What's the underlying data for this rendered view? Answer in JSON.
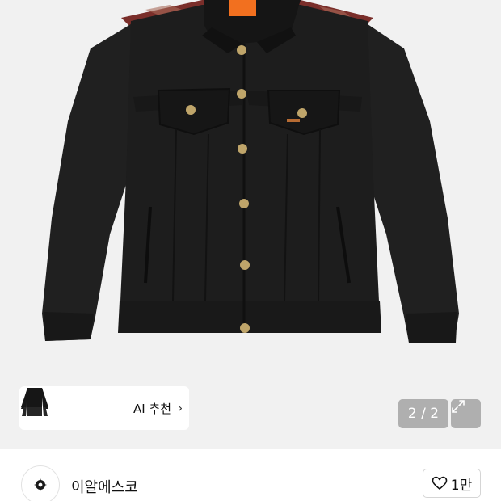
{
  "product_image": {
    "alt": "black denim trucker jacket",
    "colors": {
      "background": "#f1f1f1",
      "denim": "#1f1f1f",
      "button": "#bfa56a",
      "label": "#f2701f",
      "shoulder_trim": "#7a2e2a"
    }
  },
  "ai_recommend": {
    "label": "AI 추천",
    "chevron_icon": "chevron-right-icon",
    "thumbnails": [
      "jacket-thumbnail",
      "jacket-thumbnail",
      "jacket-thumbnail"
    ]
  },
  "pager": {
    "text": "2 / 2",
    "expand_icon": "expand-icon"
  },
  "seller": {
    "name": "이알에스코",
    "avatar_icon": "brand-logo-icon"
  },
  "like": {
    "icon": "heart-outline-icon",
    "count": "1만"
  }
}
